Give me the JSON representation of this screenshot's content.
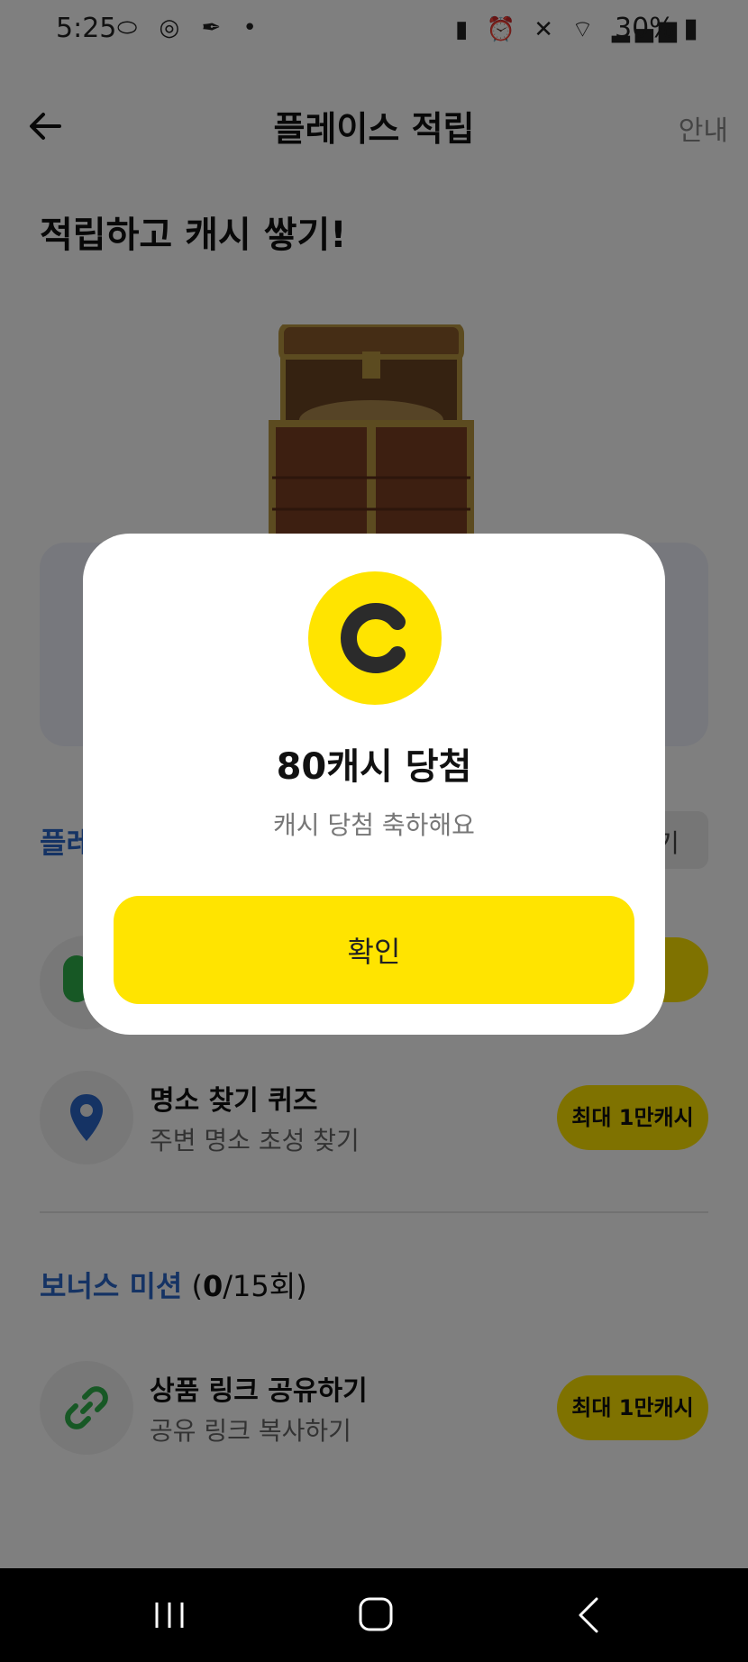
{
  "status_bar": {
    "time": "5:25",
    "battery": "30%",
    "left_icons": [
      "pill-icon",
      "signal-app-icon",
      "feather-icon",
      "dot-icon"
    ],
    "right_icons": [
      "battery-saver-icon",
      "alarm-icon",
      "mute-icon",
      "wifi-icon",
      "cell-signal-icon"
    ]
  },
  "app_bar": {
    "title": "플레이스 적립",
    "guide": "안내"
  },
  "hero": {
    "title": "적립하고 캐시 쌓기!"
  },
  "section1": {
    "title_partial": "플레",
    "right_button_partial": "기"
  },
  "missions": [
    {
      "title": "명소 찾기 퀴즈",
      "subtitle": "주변 명소 초성 찾기",
      "badge": "최대 1만캐시",
      "icon": "location-pin-icon"
    }
  ],
  "bonus": {
    "title": "보너스 미션",
    "count_done": "0",
    "count_total": "/15회)",
    "count_open": "(",
    "missions": [
      {
        "title": "상품 링크 공유하기",
        "subtitle": "공유 링크 복사하기",
        "badge": "최대 1만캐시",
        "icon": "link-icon"
      }
    ]
  },
  "dialog": {
    "icon": "coin-c-icon",
    "title": "80캐시 당첨",
    "subtitle": "캐시 당첨 축하해요",
    "confirm": "확인"
  },
  "nav_bar": {
    "buttons": [
      "recent-apps-icon",
      "home-icon",
      "back-icon"
    ]
  },
  "colors": {
    "accent_yellow": "#ffe400",
    "link_blue": "#2a66c8",
    "green": "#2eb14a"
  }
}
